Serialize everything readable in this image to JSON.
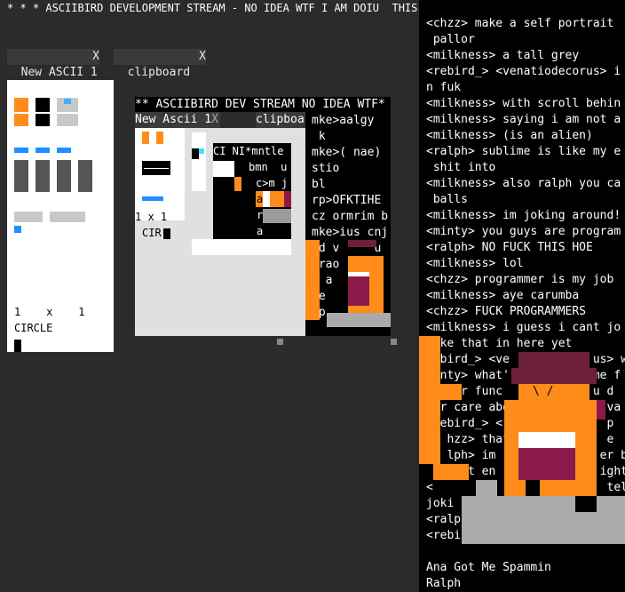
{
  "window": {
    "title": "* * * ASCIIBIRD DEVELOPMENT STREAM - NO IDEA WTF I AM DOIU  THIS WEEK HAHAHA * * *"
  },
  "tabs": [
    {
      "label": "New ASCII 1",
      "close": "X"
    },
    {
      "label": "clipboard",
      "close": "X"
    }
  ],
  "canvas": {
    "size_text": "1    x    1",
    "tool_text": "CIRCLE"
  },
  "stream": {
    "title": "** ASCIIBIRD DEV STREAM NO IDEA WTF*",
    "tab1_label": "New Ascii 1",
    "tab1_close": "X",
    "tab2_label": "clipboa",
    "size_text": "1 x 1",
    "tool_text": "CIR",
    "nested_text": "CI NI*mntle",
    "nested_lines": [
      "bmn  u",
      "c>m j",
      "a",
      "r",
      "a"
    ],
    "chat_lines": [
      "mke>aalgy",
      " k",
      "mke>( nae)",
      "stio",
      "bl",
      "rp>OFKTIHE",
      "cz ormrim b",
      "mke>ius cnj",
      "id v     u",
      "crao     v",
      "z a      l",
      "ee       h",
      "rp"
    ]
  },
  "chat": {
    "lines": [
      "<chzz> make a self portrait",
      " pallor",
      "<milkness> a tall grey",
      "<rebird_> <venatiodecorus> i",
      "n fuk",
      "<milkness> with scroll behin",
      "<milkness> saying i am not a",
      "<milkness> (is an alien)",
      "<ralph> sublime is like my e",
      " shit into",
      "<milkness> also ralph you ca",
      " balls",
      "<milkness> im joking around!",
      "<minty> you guys are program",
      "<ralph> NO FUCK THIS HOE",
      "<milkness> lol",
      "<chzz> programmer is my job",
      "<milkness> aye carumba",
      "<chzz> FUCK PROGRAMMERS",
      "<milkness> i guess i cant jo",
      "  ke that in here yet",
      "  bird_> <ve            us> w",
      "  nty> what'            me f",
      "    or func             u d",
      "  r care abo              va",
      "  ebird_> <               p",
      "   hzz> that              e",
      "   lph> im               er b",
      "     et en               ight",
      "<           i             tell",
      "joki          to",
      "<ralp",
      "<rebird_>"
    ],
    "footer_line1": "Ana Got Me Spammin",
    "footer_line2": "Ralph"
  },
  "colors": {
    "background": "#2b2b2b",
    "accent_orange": "#ff8c1a",
    "face_maroon": "#8b1a4a",
    "hat_maroon": "#6e1f3a",
    "blue": "#1e90ff"
  }
}
